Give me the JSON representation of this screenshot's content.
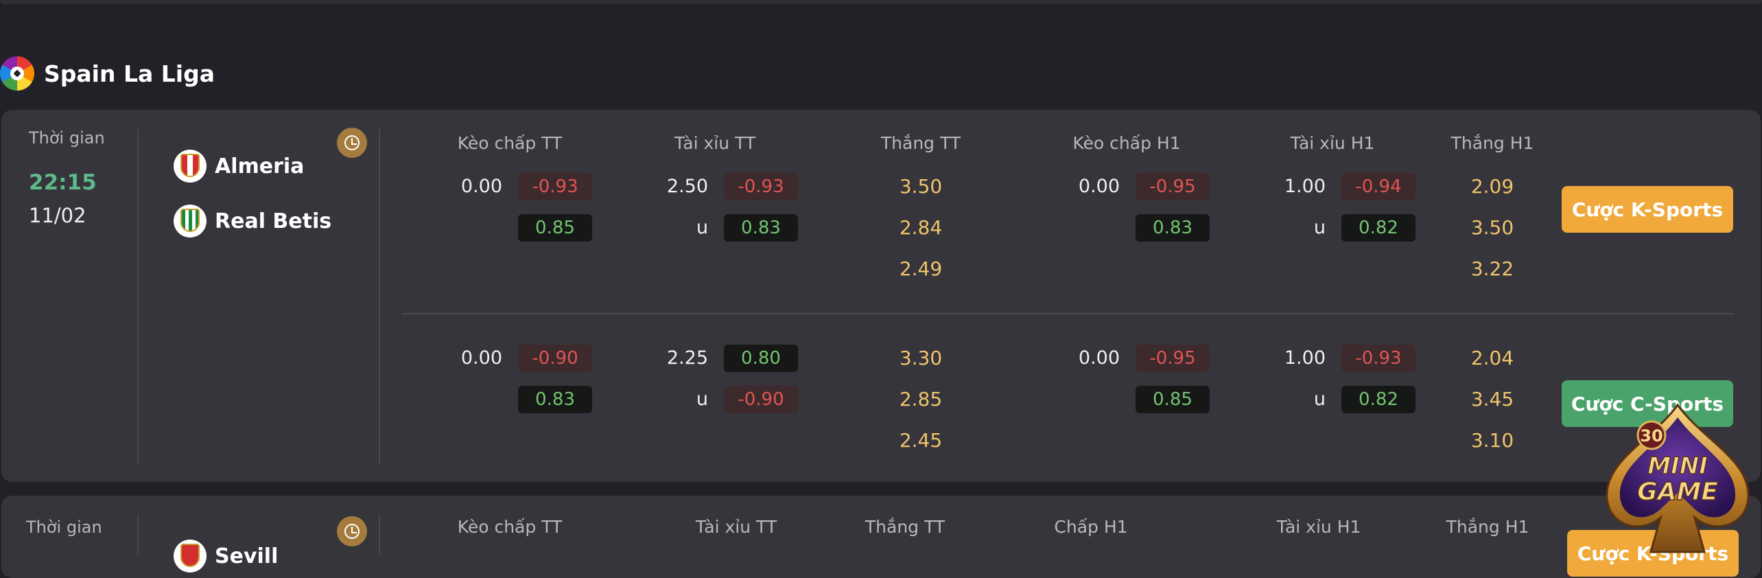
{
  "league": {
    "title": "Spain La Liga"
  },
  "labels": {
    "time": "Thời gian"
  },
  "match1": {
    "time": "22:15",
    "date": "11/02",
    "home": "Almeria",
    "away": "Real Betis"
  },
  "headers": {
    "h1": "Kèo chấp TT",
    "h2": "Tài xỉu TT",
    "h3": "Thắng TT",
    "h4": "Kèo chấp H1",
    "h5": "Tài xỉu H1",
    "h6": "Thắng H1"
  },
  "headers2": {
    "h1": "Kèo chấp TT",
    "h2": "Tài xỉu TT",
    "h3": "Thắng TT",
    "h4": "Chấp H1",
    "h5": "Tài xỉu H1",
    "h6": "Thắng H1"
  },
  "k": {
    "hdp_line": "0.00",
    "hdp_a": "-0.93",
    "hdp_b": "0.85",
    "ou_line": "2.50",
    "ou_a": "-0.93",
    "ou_u": "u",
    "ou_b": "0.83",
    "w1": "3.50",
    "w2": "2.84",
    "w3": "2.49",
    "h1hdp_line": "0.00",
    "h1hdp_a": "-0.95",
    "h1hdp_b": "0.83",
    "h1ou_line": "1.00",
    "h1ou_a": "-0.94",
    "h1ou_u": "u",
    "h1ou_b": "0.82",
    "h1w1": "2.09",
    "h1w2": "3.50",
    "h1w3": "3.22"
  },
  "c": {
    "hdp_line": "0.00",
    "hdp_a": "-0.90",
    "hdp_b": "0.83",
    "ou_line": "2.25",
    "ou_a": "0.80",
    "ou_u": "u",
    "ou_b": "-0.90",
    "w1": "3.30",
    "w2": "2.85",
    "w3": "2.45",
    "h1hdp_line": "0.00",
    "h1hdp_a": "-0.95",
    "h1hdp_b": "0.85",
    "h1ou_line": "1.00",
    "h1ou_a": "-0.93",
    "h1ou_u": "u",
    "h1ou_b": "0.82",
    "h1w1": "2.04",
    "h1w2": "3.45",
    "h1w3": "3.10"
  },
  "buttons": {
    "k_sports": "Cược K-Sports",
    "c_sports": "Cược C-Sports",
    "k_sports_partial": "Cược K-Sports"
  },
  "match2": {
    "home_partial": "Sevill"
  },
  "minigame": {
    "count": "30",
    "line1": "MINI",
    "line2": "GAME"
  },
  "colors": {
    "accent_gold": "#f0a93a",
    "accent_green": "#4aa36b",
    "time_green": "#5db88a",
    "odd_red": "#e05454",
    "odd_green": "#74c470"
  }
}
